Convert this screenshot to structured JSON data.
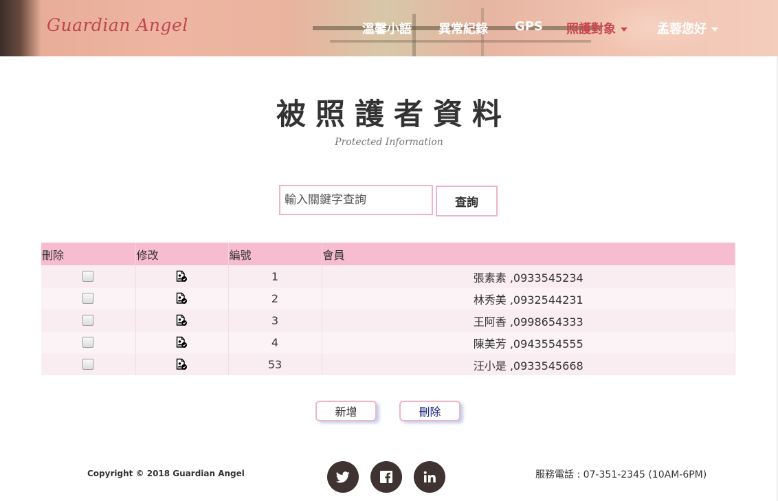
{
  "brand": {
    "logo_text": "Guardian Angel"
  },
  "nav": {
    "items": [
      {
        "label": "溫馨小語"
      },
      {
        "label": "異常紀錄"
      },
      {
        "label": "GPS"
      },
      {
        "label": "照護對象",
        "active": true,
        "dropdown": true
      },
      {
        "label": "孟蓉您好",
        "dropdown": true
      }
    ]
  },
  "page": {
    "title": "被照護者資料",
    "subtitle": "Protected Information"
  },
  "search": {
    "placeholder": "輸入關鍵字查詢",
    "button_label": "查詢"
  },
  "table": {
    "columns": [
      "刪除",
      "修改",
      "編號",
      "會員"
    ],
    "rows": [
      {
        "id": "1",
        "member": "張素素 ,0933545234"
      },
      {
        "id": "2",
        "member": "林秀美 ,0932544231"
      },
      {
        "id": "3",
        "member": "王阿香 ,0998654333"
      },
      {
        "id": "4",
        "member": "陳美芳 ,0943554555"
      },
      {
        "id": "53",
        "member": "汪小是 ,0933545668"
      }
    ]
  },
  "actions": {
    "add_label": "新增",
    "delete_label": "刪除"
  },
  "footer": {
    "copyright": "Copyright © 2018 Guardian Angel",
    "social": [
      "twitter-icon",
      "facebook-icon",
      "linkedin-icon"
    ],
    "phone": "服務電話 : 07-351-2345 (10AM-6PM)"
  },
  "colors": {
    "accent_pink": "#efb4c6",
    "table_header": "#f7bccf",
    "active_nav": "#c8474f",
    "logo": "#c0464f",
    "social_bg": "#3e3331"
  }
}
